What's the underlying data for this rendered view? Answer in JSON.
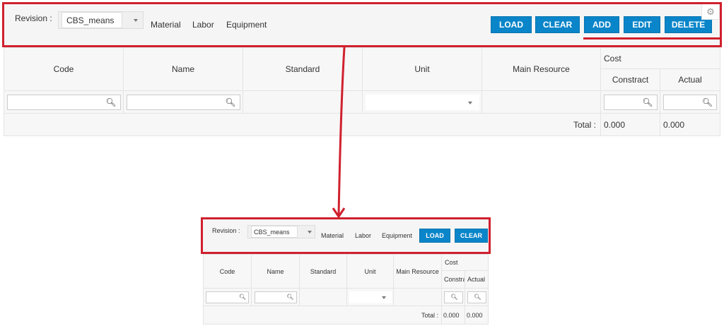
{
  "toolbar": {
    "revision_label": "Revision :",
    "revision_value": "CBS_means",
    "tabs": [
      "Material",
      "Labor",
      "Equipment"
    ],
    "buttons": {
      "load": "LOAD",
      "clear": "CLEAR",
      "add": "ADD",
      "edit": "EDIT",
      "delete": "DELETE"
    }
  },
  "table": {
    "headers": {
      "code": "Code",
      "name": "Name",
      "standard": "Standard",
      "unit": "Unit",
      "main_resource": "Main Resource",
      "cost": "Cost",
      "constract": "Constract",
      "actual": "Actual"
    },
    "total_label": "Total :",
    "total_constract": "0.000",
    "total_actual": "0.000"
  },
  "small": {
    "constract_truncated": "Constra"
  },
  "colors": {
    "accent": "#0a85c9",
    "annotation": "#d0202e"
  }
}
